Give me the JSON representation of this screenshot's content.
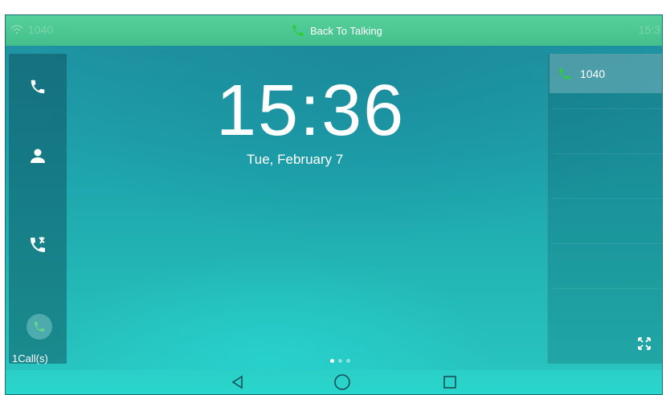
{
  "topbar": {
    "left_status": "1040",
    "back_to_talking": "Back To Talking",
    "right_status": "15:3"
  },
  "sidebar": {
    "items": [
      {
        "name": "phone",
        "icon": "phone-icon"
      },
      {
        "name": "contacts",
        "icon": "person-icon"
      },
      {
        "name": "history",
        "icon": "call-history-icon"
      }
    ],
    "calls_label": "1Call(s)"
  },
  "clock": {
    "time": "15:36",
    "date": "Tue, February 7"
  },
  "lines": {
    "active_line": "1040"
  },
  "page_indicator": {
    "pages": 3,
    "current": 1
  },
  "colors": {
    "accent_green": "#44c08c",
    "call_green": "#2ecc40"
  }
}
